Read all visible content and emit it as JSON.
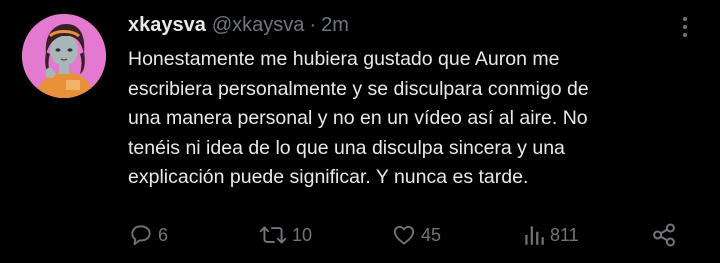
{
  "tweet": {
    "display_name": "xkaysva",
    "handle": "@xkaysva",
    "separator": "·",
    "time": "2m",
    "text_lines": [
      "Honestamente me hubiera gustado que Auron me",
      "escribiera personalmente y se disculpara conmigo de",
      "una manera personal y no en un vídeo así al aire. No",
      "tenéis ni idea de lo que una disculpa sincera y una",
      "explicación puede significar. Y nunca es tarde."
    ]
  },
  "actions": {
    "replies": "6",
    "retweets": "10",
    "likes": "45",
    "views": "811"
  },
  "icons": {
    "more": "more-icon",
    "reply": "reply-icon",
    "retweet": "retweet-icon",
    "like": "heart-icon",
    "views": "views-icon",
    "share": "share-icon"
  },
  "colors": {
    "background": "#000000",
    "text": "#e7e9ea",
    "secondary": "#71767b",
    "avatar_bg": "#e37ad0"
  }
}
